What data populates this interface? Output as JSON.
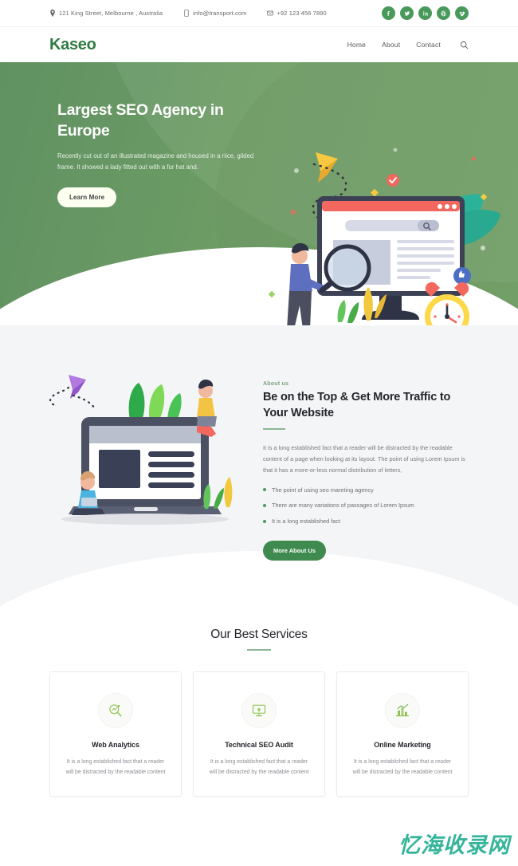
{
  "colors": {
    "brand_green": "#2f7a41",
    "hero_green": "#63985f",
    "accent_green": "#3f8a4e",
    "social_green": "#49995b",
    "rule_green": "#8bb893",
    "watermark": "#34b59a"
  },
  "topbar": {
    "address": "121 King Street, Melbourne , Australia",
    "address_icon": "location-pin-icon",
    "email": "info@transport.com",
    "email_icon": "document-icon",
    "phone": "+92 123 456 7890",
    "phone_icon": "envelope-icon",
    "social": [
      {
        "name": "facebook",
        "glyph": "f"
      },
      {
        "name": "twitter",
        "glyph": "t"
      },
      {
        "name": "linkedin",
        "glyph": "in"
      },
      {
        "name": "pinterest",
        "glyph": "p"
      },
      {
        "name": "vimeo",
        "glyph": "v"
      }
    ]
  },
  "nav": {
    "logo": "Kaseo",
    "links": [
      {
        "label": "Home"
      },
      {
        "label": "About"
      },
      {
        "label": "Contact"
      }
    ],
    "search_icon": "search-icon"
  },
  "hero": {
    "title": "Largest SEO Agency in Europe",
    "paragraph": "Recently cut out of an illustrated magazine and housed in a nice, gilded frame. It showed a lady fitted out with a fur hat and.",
    "cta": "Learn More",
    "illustration": "seo-monitor-illustration"
  },
  "about": {
    "eyebrow": "About us",
    "title": "Be on the Top & Get More Traffic to Your Website",
    "paragraph": "It is a long established fact that a reader will be distracted by the readable content of a page when looking at its layout. The point of using Lorem Ipsum is that it has a more-or-less normal distribution of letters,",
    "bullets": [
      "The point of using seo mareting agency",
      "There are many variations of passages of Lorem Ipsum",
      "It is a long established fact"
    ],
    "cta": "More About Us",
    "illustration": "laptop-people-illustration"
  },
  "services": {
    "title": "Our Best Services",
    "cards": [
      {
        "icon": "magnifier-analytics-icon",
        "title": "Web Analytics",
        "text": "It is a long established fact that a reader will be distracted by the readable content"
      },
      {
        "icon": "monitor-audit-icon",
        "title": "Technical SEO Audit",
        "text": "It is a long established fact that a reader will be distracted by the readable content"
      },
      {
        "icon": "bar-chart-growth-icon",
        "title": "Online Marketing",
        "text": "It is a long established fact that a reader will be distracted by the readable content"
      }
    ]
  },
  "watermark": {
    "text": "忆海收录网"
  }
}
